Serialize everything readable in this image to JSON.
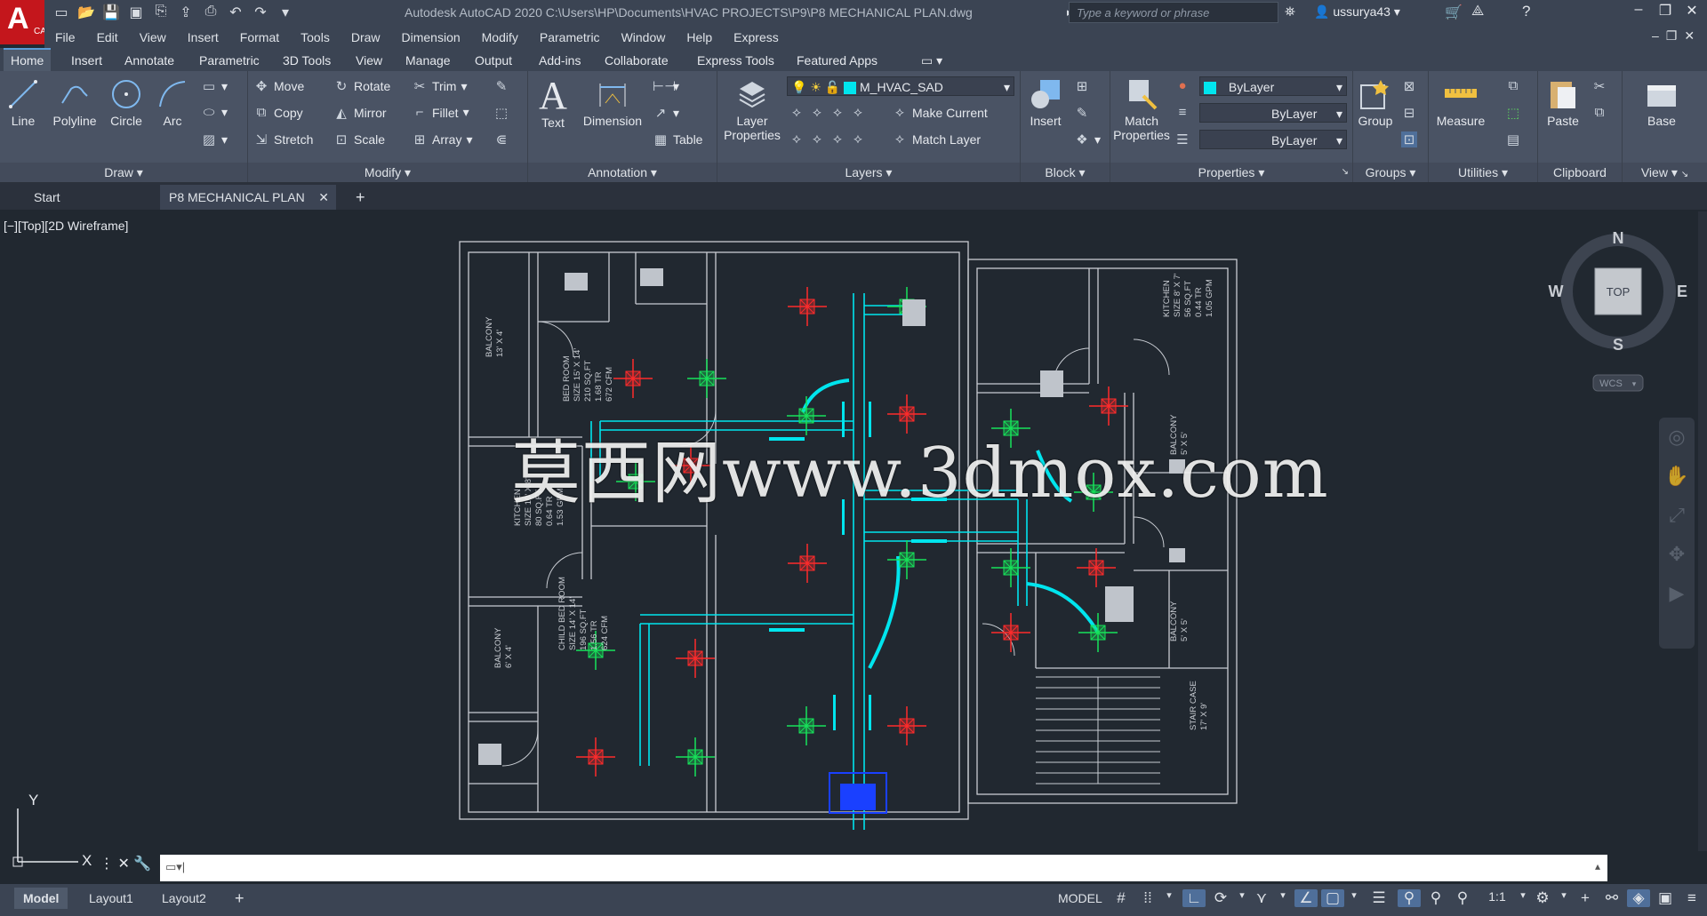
{
  "app": {
    "logo_letter": "A",
    "logo_sub": "CAD",
    "title": "Autodesk AutoCAD 2020    C:\\Users\\HP\\Documents\\HVAC PROJECTS\\P9\\P8 MECHANICAL PLAN.dwg",
    "search_placeholder": "Type a keyword or phrase",
    "user": "ussurya43",
    "colors": {
      "titlebar": "#3b4453",
      "ribbon": "#4a5364",
      "canvas": "#212830",
      "accent": "#c4161c",
      "cyan": "#00e5ee",
      "red": "#ff2b2b",
      "green": "#17e35a"
    }
  },
  "menu": [
    "File",
    "Edit",
    "View",
    "Insert",
    "Format",
    "Tools",
    "Draw",
    "Dimension",
    "Modify",
    "Parametric",
    "Window",
    "Help",
    "Express"
  ],
  "ribbon_tabs": [
    "Home",
    "Insert",
    "Annotate",
    "Parametric",
    "3D Tools",
    "View",
    "Manage",
    "Output",
    "Add-ins",
    "Collaborate",
    "Express Tools",
    "Featured Apps"
  ],
  "draw": {
    "title": "Draw",
    "line": "Line",
    "polyline": "Polyline",
    "circle": "Circle",
    "arc": "Arc"
  },
  "modify": {
    "title": "Modify",
    "move": "Move",
    "rotate": "Rotate",
    "trim": "Trim",
    "copy": "Copy",
    "mirror": "Mirror",
    "fillet": "Fillet",
    "stretch": "Stretch",
    "scale": "Scale",
    "array": "Array"
  },
  "annotation": {
    "title": "Annotation",
    "text": "Text",
    "dimension": "Dimension",
    "table": "Table"
  },
  "layers": {
    "title": "Layers",
    "layer_properties": "Layer Properties",
    "current_layer": "M_HVAC_SAD",
    "make_current": "Make Current",
    "match_layer": "Match Layer"
  },
  "block": {
    "title": "Block",
    "insert": "Insert"
  },
  "properties": {
    "title": "Properties",
    "match_properties": "Match Properties",
    "color": "ByLayer",
    "lineweight": "ByLayer",
    "linetype": "ByLayer"
  },
  "groups": {
    "title": "Groups",
    "group": "Group"
  },
  "utilities": {
    "title": "Utilities",
    "measure": "Measure"
  },
  "clipboard": {
    "title": "Clipboard",
    "paste": "Paste"
  },
  "view_panel": {
    "title": "View",
    "base": "Base"
  },
  "file_tabs": {
    "start": "Start",
    "plan": "P8 MECHANICAL PLAN"
  },
  "viewport": {
    "label": "[−][Top][2D Wireframe]"
  },
  "viewcube": {
    "n": "N",
    "s": "S",
    "e": "E",
    "w": "W",
    "top": "TOP",
    "wcs": "WCS"
  },
  "ucs": {
    "x": "X",
    "y": "Y"
  },
  "watermark": "莫西网www.3dmox.com",
  "rooms": [
    {
      "name": "BALCONY",
      "size": "13' X 4'"
    },
    {
      "name": "BED ROOM",
      "size": "SIZE 15' X 14'",
      "area": "210 SQ.FT",
      "tr": "1.68 TR",
      "cfm": "672 CFM"
    },
    {
      "name": "KITCHEN",
      "size": "SIZE 10' X 8'",
      "area": "80 SQ.FT",
      "tr": "0.64 TR",
      "cfm": "1.53 GPM"
    },
    {
      "name": "BALCONY",
      "size": "6' X 4'"
    },
    {
      "name": "CHILD BED ROOM",
      "size": "SIZE 14' X 14'",
      "area": "196 SQ.FT",
      "tr": "1.56 TR",
      "cfm": "624 CFM"
    },
    {
      "name": "KITCHEN",
      "size": "SIZE 8' X 7'",
      "area": "56 SQ.FT",
      "tr": "0.44 TR",
      "cfm": "1.05 GPM"
    },
    {
      "name": "BALCONY",
      "size": "5' X 5'"
    },
    {
      "name": "BALCONY",
      "size": "5' X 5'"
    },
    {
      "name": "STAIR CASE",
      "size": "17' X 9'"
    }
  ],
  "layouts": {
    "model": "Model",
    "layout1": "Layout1",
    "layout2": "Layout2"
  },
  "status": {
    "model": "MODEL",
    "scale": "1:1"
  }
}
